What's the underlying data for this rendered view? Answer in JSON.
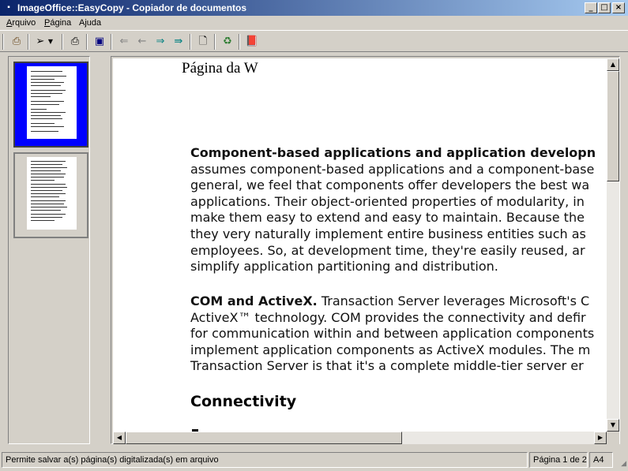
{
  "window": {
    "title": "ImageOffice::EasyCopy - Copiador de documentos",
    "minimize": "_",
    "maximize": "□",
    "close": "×"
  },
  "menu": [
    {
      "label": "Arquivo",
      "accel": "A",
      "rest": "rquivo"
    },
    {
      "label": "Página",
      "accel": "P",
      "rest": "ágina"
    },
    {
      "label": "Ajuda",
      "accel": "",
      "rest": "Ajuda"
    }
  ],
  "toolbar": {
    "icons": [
      "scanner-icon",
      "send-icon",
      "dropdown-arrow-icon",
      "print-icon",
      "save-icon",
      "first-page-icon",
      "prev-page-icon",
      "next-page-icon",
      "last-page-icon",
      "document-icon",
      "recycle-icon",
      "help-book-icon"
    ]
  },
  "document": {
    "header": "Página da W",
    "paragraph1": [
      {
        "bold": "Component-based applications and application developn",
        "text": ""
      },
      {
        "bold": "",
        "text": "assumes component-based applications and a component-base"
      },
      {
        "bold": "",
        "text": "general, we feel that components offer developers the best wa"
      },
      {
        "bold": "",
        "text": "applications. Their object-oriented properties of modularity, in"
      },
      {
        "bold": "",
        "text": "make them easy to extend and easy to maintain. Because the"
      },
      {
        "bold": "",
        "text": "they very naturally implement entire business entities such as"
      },
      {
        "bold": "",
        "text": "employees. So, at development time, they're easily reused, ar"
      },
      {
        "bold": "",
        "text": "simplify application partitioning and distribution."
      }
    ],
    "paragraph2": [
      {
        "bold": "COM and ActiveX.",
        "text": " Transaction Server leverages Microsoft's C"
      },
      {
        "bold": "",
        "text": "ActiveX™ technology. COM provides the connectivity and defir"
      },
      {
        "bold": "",
        "text": "for communication within and between application components"
      },
      {
        "bold": "",
        "text": "implement application components as ActiveX modules. The m"
      },
      {
        "bold": "",
        "text": "Transaction Server is that it's a complete middle-tier server er"
      }
    ],
    "heading": "Connectivity"
  },
  "status": {
    "message": "Permite salvar a(s) página(s) digitalizada(s) em arquivo",
    "page": "Página 1 de 2",
    "paper": "A4"
  },
  "colors": {
    "selected_thumb": "#0000ff",
    "titlebar_start": "#0a246a",
    "titlebar_end": "#a6caf0"
  }
}
